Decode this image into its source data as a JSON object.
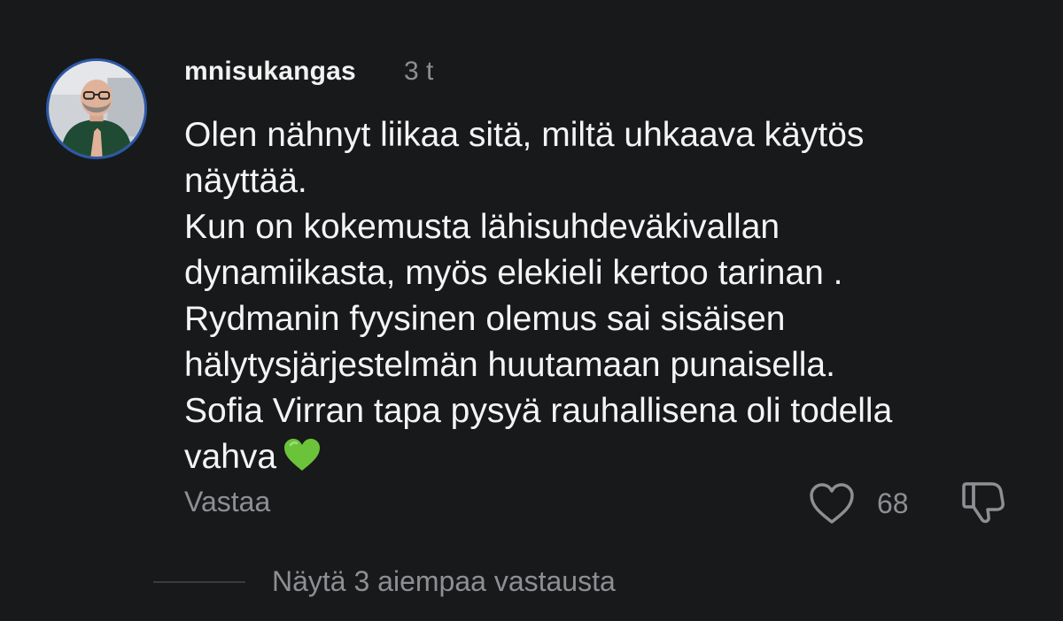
{
  "comment": {
    "username": "mnisukangas",
    "time": "3 t",
    "text": "Olen nähnyt liikaa sitä, miltä uhkaava käytös\nnäyttää.\nKun on kokemusta lähisuhdeväkivallan\ndynamiikasta, myös elekieli kertoo tarinan .\nRydmanin fyysinen olemus sai sisäisen\nhälytysjärjestelmän huutamaan punaisella.\nSofia Virran tapa pysyä rauhallisena oli todella\nvahva",
    "emoji": "green-heart-icon",
    "reply_label": "Vastaa",
    "like_count": "68",
    "show_replies_label": "Näytä 3 aiempaa vastausta"
  },
  "colors": {
    "background": "#18191b",
    "text": "#f4f4f4",
    "muted": "#8e8f92",
    "emoji_green": "#6bc33a",
    "avatar_ring": "#2c58a8"
  }
}
